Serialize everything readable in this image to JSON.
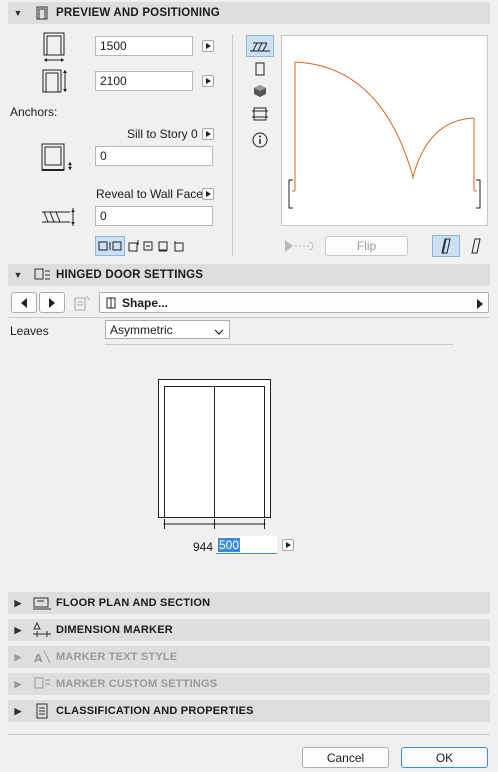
{
  "preview": {
    "title": "PREVIEW AND POSITIONING",
    "width_value": "1500",
    "height_value": "2100",
    "anchors_label": "Anchors:",
    "sill_label": "Sill to Story 0",
    "sill_value": "0",
    "reveal_label": "Reveal to Wall Face",
    "reveal_value": "0",
    "flip_label": "Flip"
  },
  "hinged": {
    "title": "HINGED DOOR SETTINGS",
    "shape_label": "Shape...",
    "leaves_label": "Leaves",
    "leaves_value": "Asymmetric",
    "dim_left": "944",
    "dim_right": "500"
  },
  "sections": {
    "floor_plan": "FLOOR PLAN AND SECTION",
    "dimension_marker": "DIMENSION MARKER",
    "marker_text_style": "MARKER TEXT STYLE",
    "marker_custom": "MARKER CUSTOM SETTINGS",
    "classification": "CLASSIFICATION AND PROPERTIES"
  },
  "footer": {
    "cancel_label": "Cancel",
    "ok_label": "OK"
  },
  "colors": {
    "accent": "#3c8bd6",
    "door_swing": "#d9661f",
    "header_bg": "#dedede"
  }
}
